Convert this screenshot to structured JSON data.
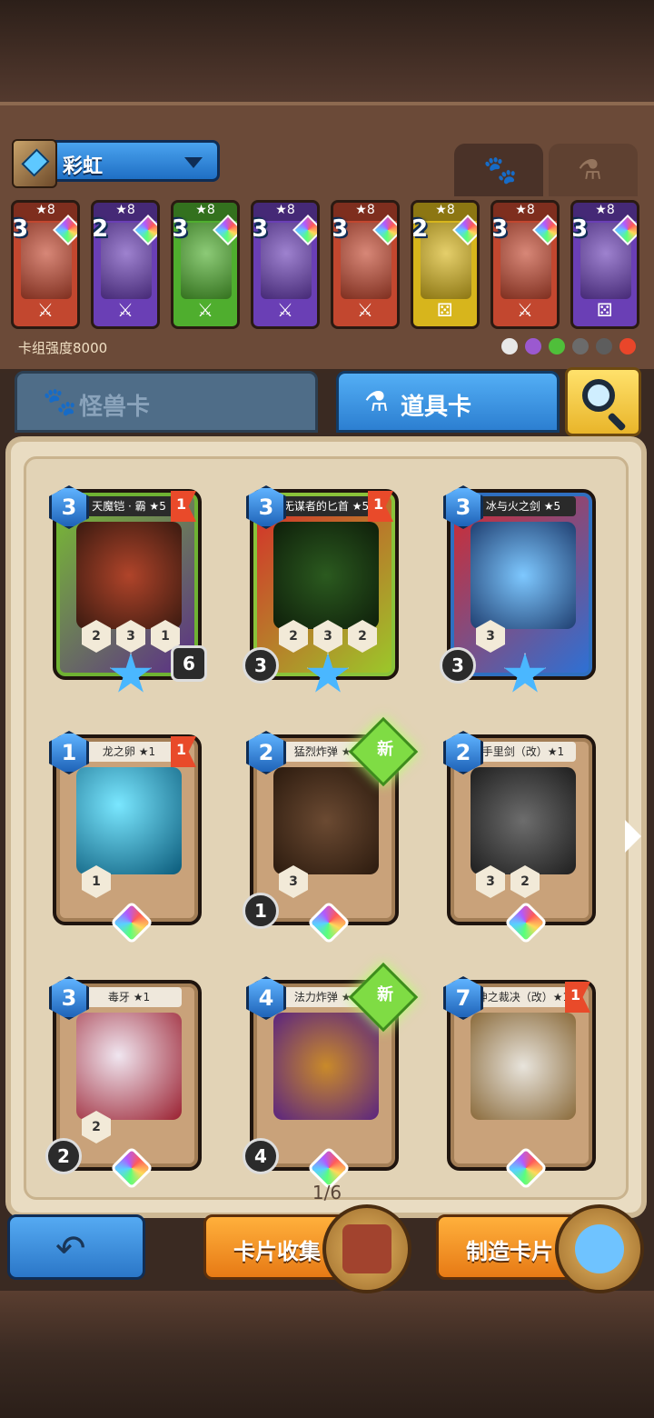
{
  "deck": {
    "name": "彩虹",
    "strength_label": "卡组强度8000",
    "cards": [
      {
        "cost": "3",
        "stars": "★8",
        "color": "#c2472f",
        "item_icon": "sword"
      },
      {
        "cost": "2",
        "stars": "★8",
        "color": "#6a3fb5",
        "item_icon": "sword-staff"
      },
      {
        "cost": "3",
        "stars": "★8",
        "color": "#4fae2e",
        "item_icon": "staff"
      },
      {
        "cost": "3",
        "stars": "★8",
        "color": "#6a3fb5",
        "item_icon": "sword"
      },
      {
        "cost": "3",
        "stars": "★8",
        "color": "#c2472f",
        "item_icon": "sword"
      },
      {
        "cost": "2",
        "stars": "★8",
        "color": "#d7b51c",
        "item_icon": "dice"
      },
      {
        "cost": "3",
        "stars": "★8",
        "color": "#c2472f",
        "item_icon": "sword"
      },
      {
        "cost": "3",
        "stars": "★8",
        "color": "#6a3fb5",
        "item_icon": "dice-staff"
      }
    ]
  },
  "tabs": {
    "monster": "怪兽卡",
    "item": "道具卡"
  },
  "cards": [
    {
      "name": "天魔铠 · 霸 ★5",
      "cost": "3",
      "flag": "1",
      "rarity": "legend",
      "stats": [
        "2",
        "3",
        "1"
      ],
      "corner": "6"
    },
    {
      "name": "无谋者的匕首 ★5",
      "cost": "3",
      "flag": "1",
      "rarity": "legend",
      "stats": [
        "2",
        "3",
        "2"
      ],
      "corner": "3"
    },
    {
      "name": "冰与火之剑 ★5",
      "cost": "3",
      "flag": "",
      "rarity": "legend",
      "stats": [
        "3"
      ],
      "corner": "3"
    },
    {
      "name": "龙之卵 ★1",
      "cost": "1",
      "flag": "1",
      "rarity": "common",
      "stats": [
        "1"
      ],
      "corner": ""
    },
    {
      "name": "猛烈炸弹 ★1",
      "cost": "2",
      "flag": "",
      "new": "新",
      "rarity": "common",
      "stats": [
        "3"
      ],
      "corner": "1"
    },
    {
      "name": "手里剑（改）★1",
      "cost": "2",
      "flag": "",
      "rarity": "common",
      "stats": [
        "3",
        "2"
      ],
      "corner": ""
    },
    {
      "name": "毒牙 ★1",
      "cost": "3",
      "flag": "",
      "rarity": "common",
      "stats": [
        "2"
      ],
      "corner": "2"
    },
    {
      "name": "法力炸弹 ★1",
      "cost": "4",
      "flag": "",
      "new": "新",
      "rarity": "common",
      "stats": [],
      "corner": "4"
    },
    {
      "name": "神之裁决（改）★1",
      "cost": "7",
      "flag": "1",
      "rarity": "common",
      "stats": [],
      "corner": ""
    }
  ],
  "pager": "1/6",
  "buttons": {
    "collect": "卡片收集",
    "craft": "制造卡片"
  }
}
